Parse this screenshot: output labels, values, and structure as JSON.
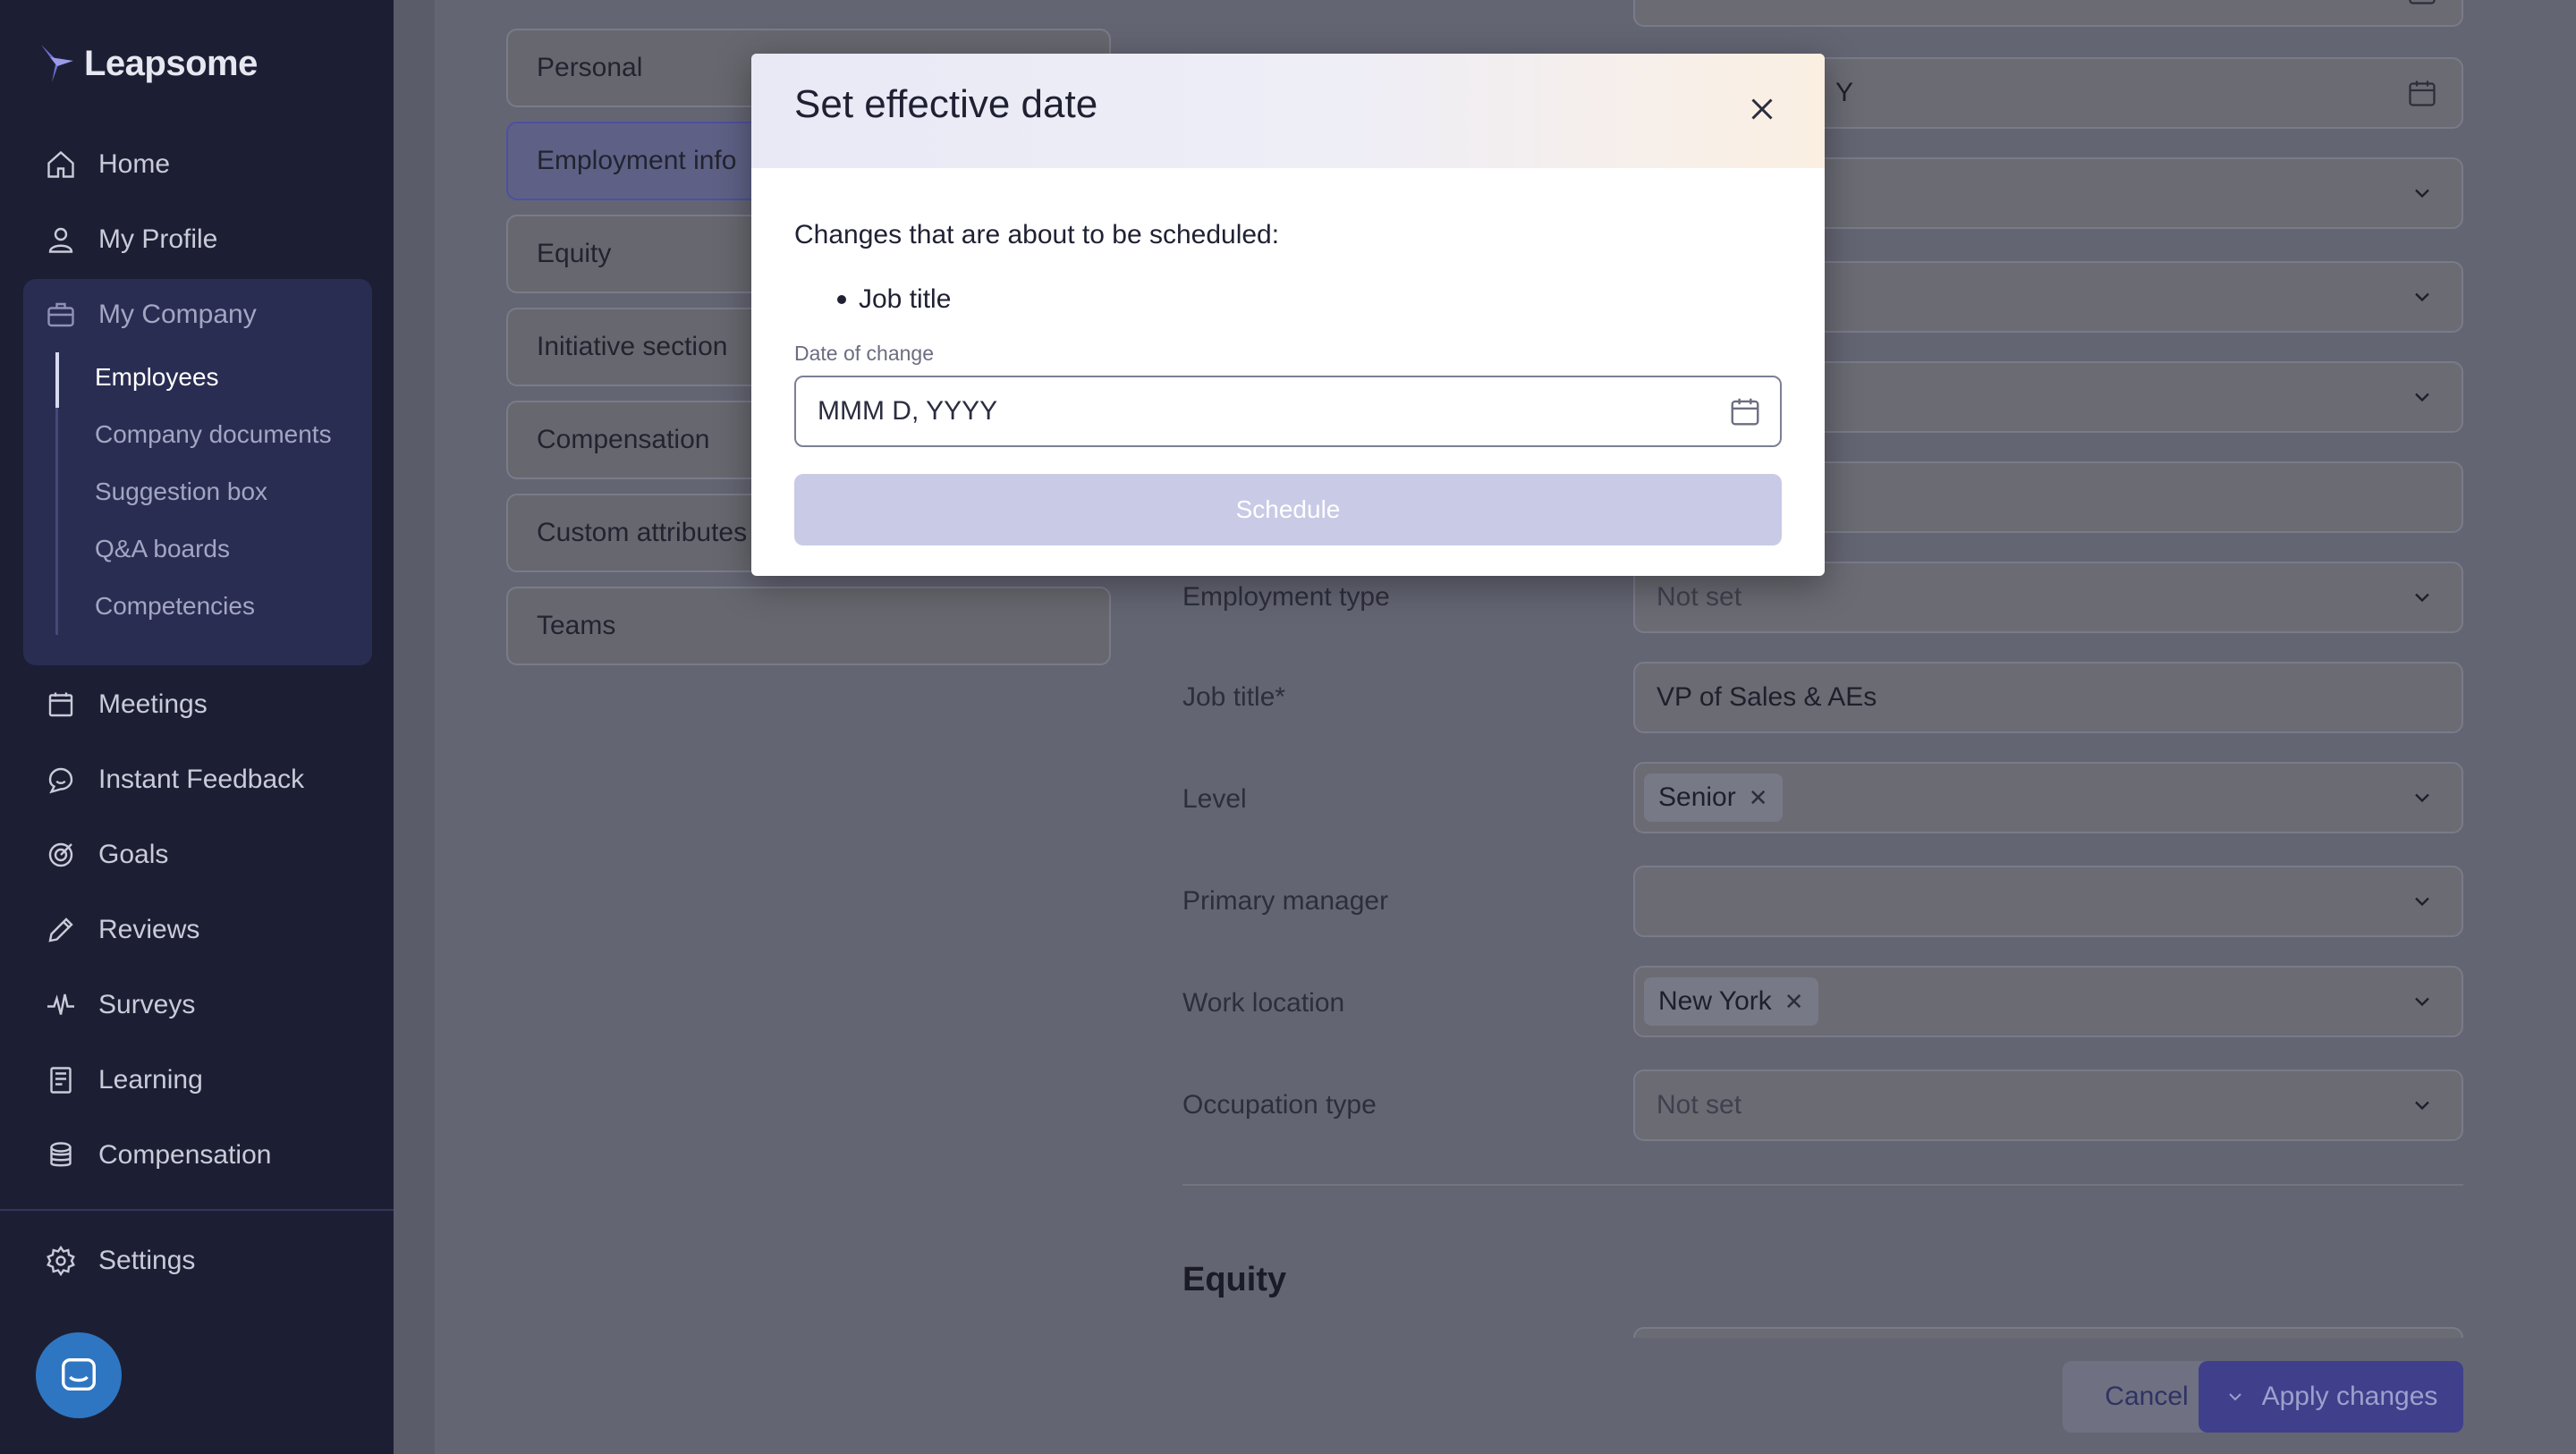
{
  "app": {
    "name": "Leapsome"
  },
  "sidebar": {
    "items": [
      {
        "label": "Home",
        "icon": "home-icon"
      },
      {
        "label": "My Profile",
        "icon": "user-icon"
      },
      {
        "label": "My Company",
        "icon": "briefcase-icon"
      },
      {
        "label": "Meetings",
        "icon": "calendar-icon"
      },
      {
        "label": "Instant Feedback",
        "icon": "chat-bubble-icon"
      },
      {
        "label": "Goals",
        "icon": "target-icon"
      },
      {
        "label": "Reviews",
        "icon": "pencil-icon"
      },
      {
        "label": "Surveys",
        "icon": "pulse-icon"
      },
      {
        "label": "Learning",
        "icon": "book-icon"
      },
      {
        "label": "Compensation",
        "icon": "coins-icon"
      }
    ],
    "company_sub_items": [
      "Employees",
      "Company documents",
      "Suggestion box",
      "Q&A boards",
      "Competencies"
    ],
    "settings_label": "Settings"
  },
  "sections": [
    "Personal",
    "Employment info",
    "Equity",
    "Initiative section",
    "Compensation",
    "Custom attributes",
    "Teams"
  ],
  "fields": {
    "employment_type": {
      "label": "Employment type",
      "value": "Not set"
    },
    "job_title": {
      "label": "Job title*",
      "value": "VP of Sales & AEs"
    },
    "level": {
      "label": "Level",
      "chip": "Senior"
    },
    "primary_manager": {
      "label": "Primary manager",
      "value": ""
    },
    "work_location": {
      "label": "Work location",
      "chip": "New York"
    },
    "occupation_type": {
      "label": "Occupation type",
      "value": "Not set"
    },
    "top_partial_date": "Y"
  },
  "equity_heading": "Equity",
  "footer": {
    "cancel_label": "Cancel",
    "apply_label": "Apply changes"
  },
  "modal": {
    "title": "Set effective date",
    "description": "Changes that are about to be scheduled:",
    "changes": [
      "Job title"
    ],
    "date_label": "Date of change",
    "date_placeholder": "MMM D, YYYY",
    "schedule_label": "Schedule"
  },
  "colors": {
    "sidebar_bg": "#1c1f33",
    "accent": "#3f3f8c",
    "schedule_disabled": "#c9cae6"
  }
}
